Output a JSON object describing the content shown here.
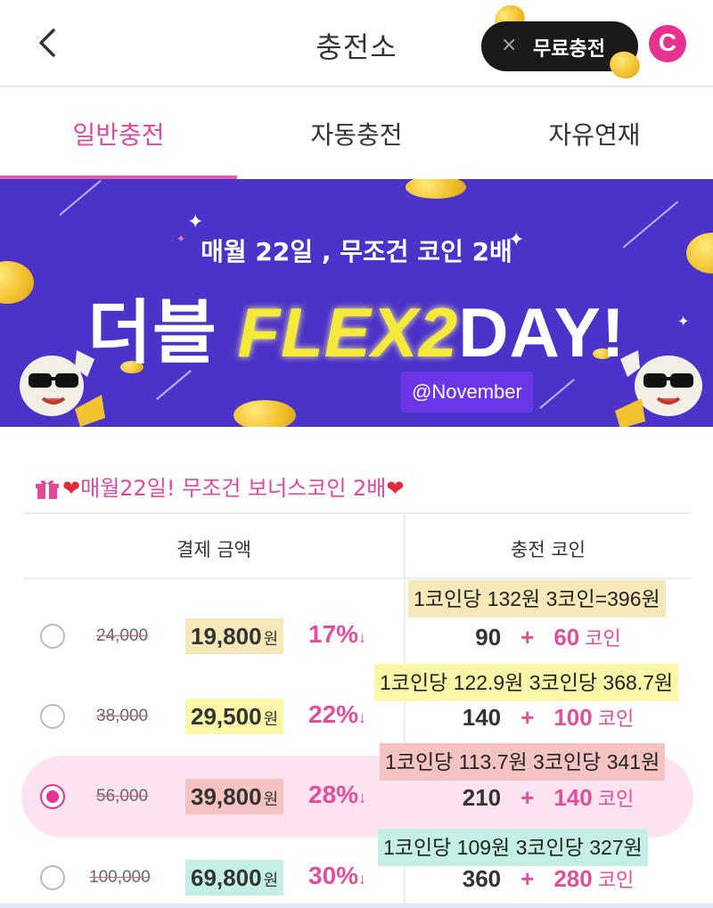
{
  "header": {
    "back_icon": "chevron-left-icon",
    "title": "충전소",
    "free_charge": {
      "close": "×",
      "label": "무료충전"
    },
    "badge": "C"
  },
  "tabs": [
    {
      "label": "일반충전",
      "active": true
    },
    {
      "label": "자동충전",
      "active": false
    },
    {
      "label": "자유연재",
      "active": false
    }
  ],
  "banner": {
    "subtitle": "매월 22일 , 무조건 코인 2배",
    "title_left": "더블",
    "title_flex": "FLEX2",
    "title_right": "DAY!",
    "tag": "@November"
  },
  "promo": {
    "heart": "❤",
    "text": "매월22일! 무조건 보너스코인 2배"
  },
  "table": {
    "col_price": "결제 금액",
    "col_coins": "충전 코인",
    "rows": [
      {
        "selected": false,
        "original": "24,000",
        "price": "19,800",
        "won": "원",
        "discount": "17%",
        "arrow": "↓",
        "base": "90",
        "plus": "+",
        "bonus": "60",
        "unit": "코인",
        "note": "1코인당 132원  3코인=396원",
        "note_color": "#f6e8b8",
        "price_color": "#f6e8b8"
      },
      {
        "selected": false,
        "original": "38,000",
        "price": "29,500",
        "won": "원",
        "discount": "22%",
        "arrow": "↓",
        "base": "140",
        "plus": "+",
        "bonus": "100",
        "unit": "코인",
        "note": "1코인당 122.9원  3코인당 368.7원",
        "note_color": "#fbf7a8",
        "price_color": "#fbf7a8"
      },
      {
        "selected": true,
        "original": "56,000",
        "price": "39,800",
        "won": "원",
        "discount": "28%",
        "arrow": "↓",
        "base": "210",
        "plus": "+",
        "bonus": "140",
        "unit": "코인",
        "note": "1코인당 113.7원  3코인당 341원",
        "note_color": "#f6c3c3",
        "price_color": "#f6c3c3"
      },
      {
        "selected": false,
        "original": "100,000",
        "price": "69,800",
        "won": "원",
        "discount": "30%",
        "arrow": "↓",
        "base": "360",
        "plus": "+",
        "bonus": "280",
        "unit": "코인",
        "note": "1코인당 109원  3코인당 327원",
        "note_color": "#c4efe4",
        "price_color": "#c4efe4"
      }
    ]
  }
}
